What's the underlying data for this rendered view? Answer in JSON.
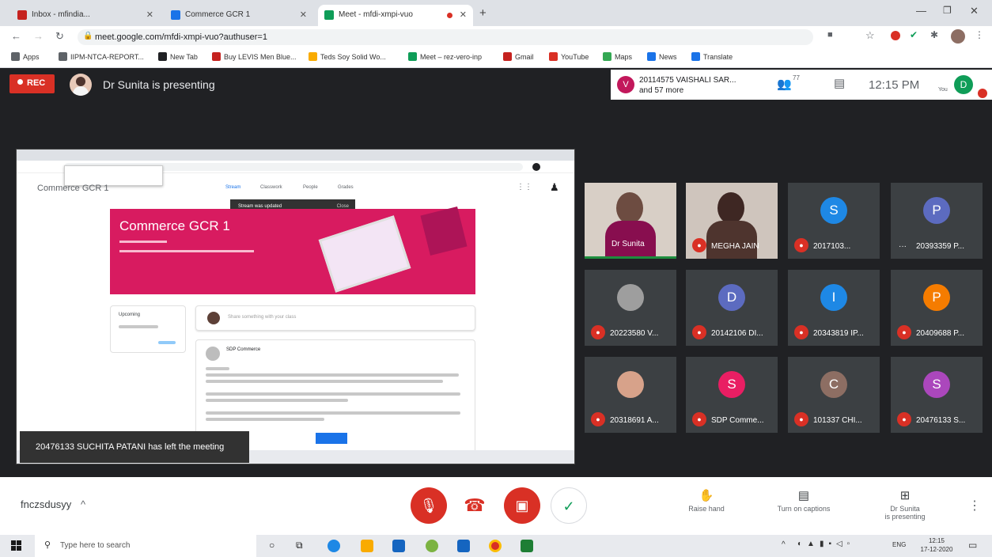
{
  "browser": {
    "tabs": [
      {
        "label": "Inbox - mfindia...",
        "color": "#c5221f"
      },
      {
        "label": "Commerce GCR 1",
        "color": "#1a73e8"
      },
      {
        "label": "Meet - mfdi-xmpi-vuo",
        "color": "#0f9d58"
      }
    ],
    "url": "meet.google.com/mfdi-xmpi-vuo?authuser=1",
    "bookmarks": [
      {
        "label": "Apps",
        "color": "#5f6368"
      },
      {
        "label": "IIPM-NTCA-REPORT...",
        "color": "#5f6368"
      },
      {
        "label": "New Tab",
        "color": "#202124"
      },
      {
        "label": "Buy LEVIS Men Blue...",
        "color": "#c5221f"
      },
      {
        "label": "Teds Soy Solid Wo...",
        "color": "#f9ab00"
      },
      {
        "label": "Meet – rez-vero-inp",
        "color": "#0f9d58"
      },
      {
        "label": "Gmail",
        "color": "#c5221f"
      },
      {
        "label": "YouTube",
        "color": "#d93025"
      },
      {
        "label": "Maps",
        "color": "#34a853"
      },
      {
        "label": "News",
        "color": "#1a73e8"
      },
      {
        "label": "Translate",
        "color": "#1a73e8"
      }
    ]
  },
  "meet": {
    "rec_label": "REC",
    "presenter_text": "Dr Sunita is presenting",
    "joined_initial": "V",
    "joined_line1": "20114575 VAISHALI SAR...",
    "joined_line2": "and 57 more",
    "people_count": "77",
    "time": "12:15 PM",
    "you_label": "You",
    "user_initial": "D"
  },
  "shared_screen": {
    "class_title": "Commerce GCR 1",
    "course_header": "Commerce GCR 1",
    "nav_tabs": [
      "Stream",
      "Classwork",
      "People",
      "Grades"
    ],
    "snackbar": "Stream was updated",
    "snackbar_action": "Close",
    "upcoming_label": "Upcoming",
    "announce_placeholder": "Share something with your class",
    "post_author": "SDP Commerce",
    "left_toast": "20476133 SUCHITA PATANI has left the meeting"
  },
  "participants": [
    {
      "name": "Dr Sunita",
      "initial": "",
      "color": "#8d6e63",
      "photo": true
    },
    {
      "name": "MEGHA JAIN",
      "initial": "",
      "color": "#6d4c41",
      "photo": true
    },
    {
      "name": "2017103...",
      "initial": "S",
      "color": "#1e88e5",
      "photo": false
    },
    {
      "name": "20393359 P...",
      "initial": "P",
      "color": "#5c6bc0",
      "photo": false
    },
    {
      "name": "20223580 V...",
      "initial": "",
      "color": "#9e9e9e",
      "photo": false
    },
    {
      "name": "20142106 DI...",
      "initial": "D",
      "color": "#5c6bc0",
      "photo": false
    },
    {
      "name": "20343819 IP...",
      "initial": "I",
      "color": "#1e88e5",
      "photo": false
    },
    {
      "name": "20409688 P...",
      "initial": "P",
      "color": "#f57c00",
      "photo": false
    },
    {
      "name": "20318691 A...",
      "initial": "",
      "color": "#d7a28a",
      "photo": false
    },
    {
      "name": "SDP Comme...",
      "initial": "S",
      "color": "#e91e63",
      "photo": false
    },
    {
      "name": "101337 CHI...",
      "initial": "C",
      "color": "#8d6e63",
      "photo": false
    },
    {
      "name": "20476133 S...",
      "initial": "S",
      "color": "#ab47bc",
      "photo": false
    }
  ],
  "controls": {
    "meeting_code": "fnczsdusyy",
    "raise_hand": "Raise hand",
    "captions": "Turn on captions",
    "presenting_line1": "Dr Sunita",
    "presenting_line2": "is presenting"
  },
  "taskbar": {
    "search_placeholder": "Type here to search",
    "tray_lang": "ENG",
    "tray_time": "12:15",
    "tray_date": "17-12-2020"
  },
  "colors": {
    "meet_dark": "#202124",
    "rec_red": "#d93025",
    "banner_pink": "#d81b60",
    "accent_green": "#0f9d58"
  }
}
